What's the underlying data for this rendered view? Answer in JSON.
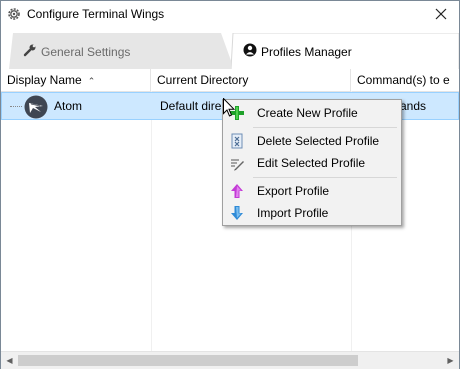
{
  "window": {
    "title": "Configure Terminal Wings"
  },
  "tabs": [
    {
      "label": "General Settings",
      "icon": "wrench-icon",
      "active": false
    },
    {
      "label": "Profiles Manager",
      "icon": "user-circle-icon",
      "active": true
    }
  ],
  "grid": {
    "columns": [
      {
        "label": "Display Name",
        "sorted": "ascending"
      },
      {
        "label": "Current Directory"
      },
      {
        "label": "Command(s) to e"
      }
    ],
    "rows": [
      {
        "name": "Atom",
        "directory": "Default dire",
        "commands": "mands",
        "selected": true,
        "icon": "atom-logo"
      }
    ]
  },
  "context_menu": {
    "items": [
      {
        "label": "Create New Profile",
        "icon": "green-plus-icon"
      },
      {
        "label": "Delete Selected Profile",
        "icon": "delete-file-icon"
      },
      {
        "label": "Edit Selected Profile",
        "icon": "edit-pencil-icon"
      },
      {
        "label": "Export Profile",
        "icon": "export-arrow-icon"
      },
      {
        "label": "Import Profile",
        "icon": "import-arrow-icon"
      }
    ]
  },
  "colors": {
    "selection_bg": "#cde8ff",
    "selection_border": "#99d1ff",
    "menu_bg": "#f2f2f2",
    "tab_inactive_bg": "#e6e6e6"
  }
}
